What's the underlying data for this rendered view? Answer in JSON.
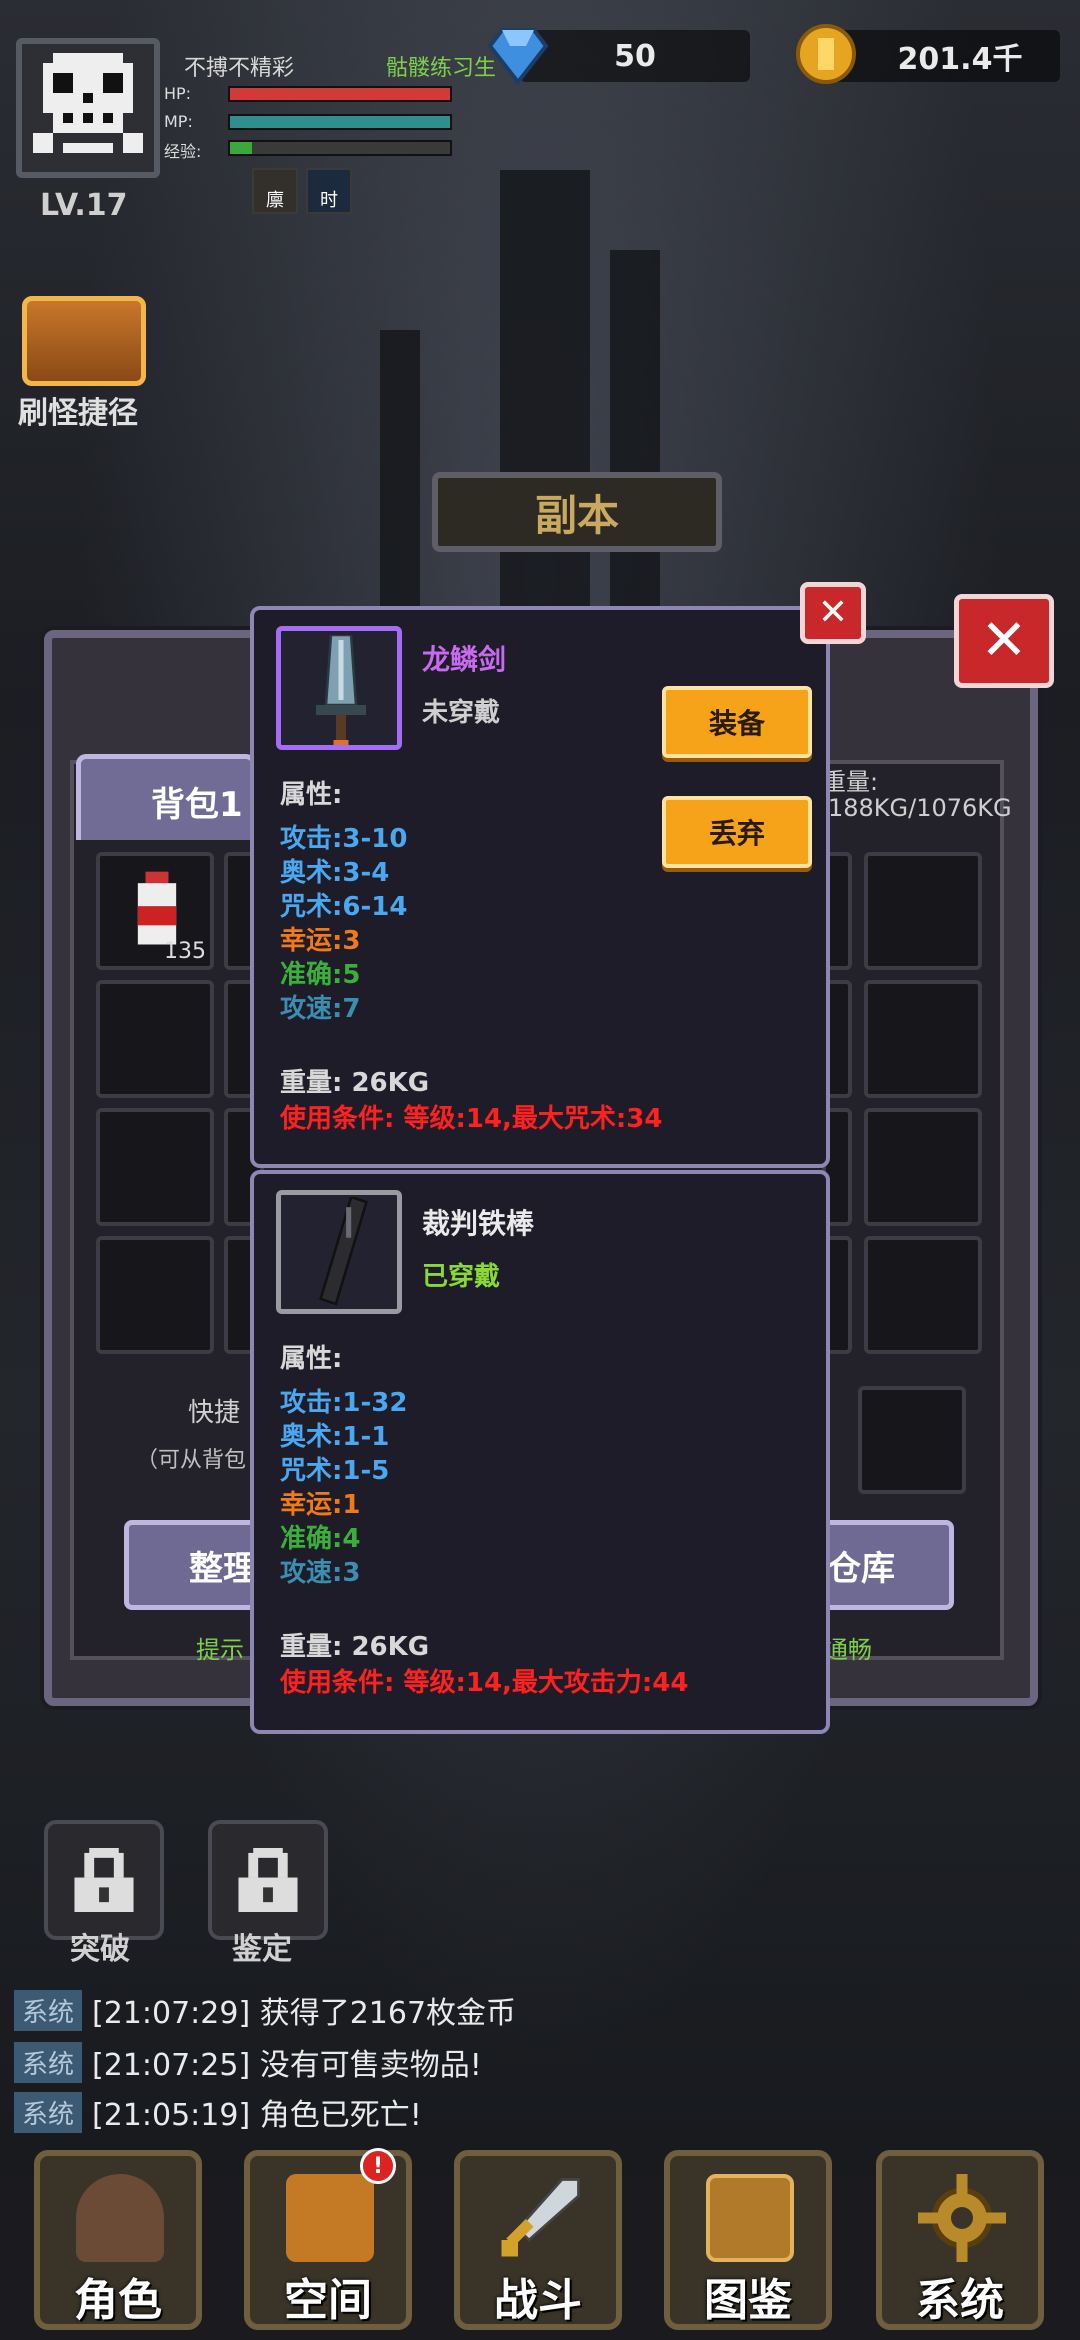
{
  "hud": {
    "level": "LV.17",
    "player_name": "不搏不精彩",
    "player_title": "骷髅练习生",
    "hp_label": "HP:",
    "mp_label": "MP:",
    "exp_label": "经验:",
    "hp_percent": 100,
    "mp_percent": 100,
    "exp_percent": 10,
    "buffs": [
      "廪",
      "时"
    ],
    "gems": "50",
    "gold": "201.4千",
    "colors": {
      "hp": "#d23a3a",
      "mp": "#2e8f8f",
      "exp": "#3aa83a"
    }
  },
  "shortcut": {
    "label": "刷怪捷径"
  },
  "dungeon": {
    "label": "副本"
  },
  "backpack": {
    "tab_label": "背包1",
    "weight_label": "重量:",
    "weight_value": "188KG/1076KG",
    "item_qty": "135",
    "quick_label": "快捷",
    "quick_hint": "（可从背包",
    "sort_button": "整理",
    "warehouse_button": "仓库",
    "hint_left": "提示",
    "hint_right": "通畅"
  },
  "card1": {
    "name": "龙鳞剑",
    "state": "未穿戴",
    "attr_title": "属性:",
    "attrs": [
      "攻击:3-10",
      "奥术:3-4",
      "咒术:6-14",
      "幸运:3",
      "准确:5",
      "攻速:7"
    ],
    "weight": "重量: 26KG",
    "condition": "使用条件: 等级:14,最大咒术:34",
    "equip_button": "装备",
    "discard_button": "丢弃",
    "close": "✕"
  },
  "card2": {
    "name": "裁判铁棒",
    "state": "已穿戴",
    "attr_title": "属性:",
    "attrs": [
      "攻击:1-32",
      "奥术:1-1",
      "咒术:1-5",
      "幸运:1",
      "准确:4",
      "攻速:3"
    ],
    "weight": "重量: 26KG",
    "condition": "使用条件: 等级:14,最大攻击力:44"
  },
  "panel_close": "✕",
  "locks": {
    "breakthrough": "突破",
    "appraise": "鉴定"
  },
  "log": [
    {
      "tag": "系统",
      "text": "[21:07:29] 获得了2167枚金币"
    },
    {
      "tag": "系统",
      "text": "[21:07:25] 没有可售卖物品!"
    },
    {
      "tag": "系统",
      "text": "[21:05:19] 角色已死亡!"
    }
  ],
  "nav": {
    "character": "角色",
    "space": "空间",
    "space_badge": "!",
    "battle": "战斗",
    "codex": "图鉴",
    "system": "系统"
  }
}
